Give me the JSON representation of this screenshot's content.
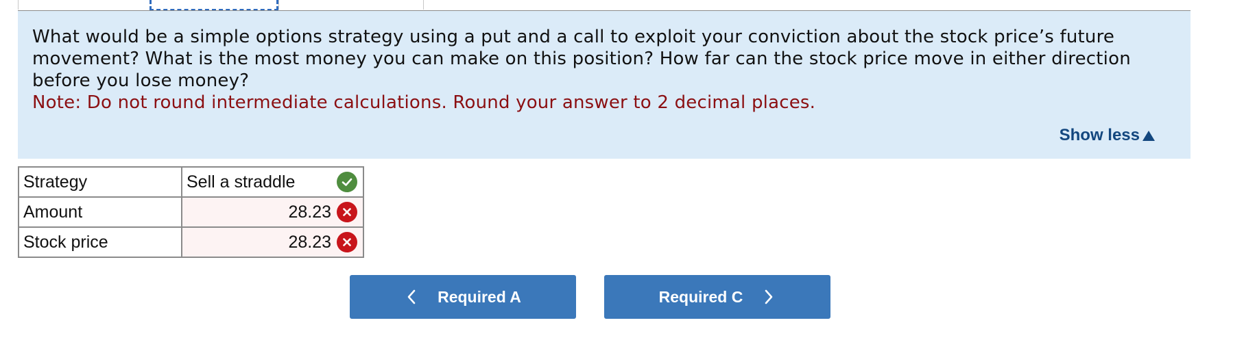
{
  "question": {
    "text": "What would be a simple options strategy using a put and a call to exploit your conviction about the stock price’s future movement? What is the most money you can make on this position? How far can the stock price move in either direction before you lose money?",
    "note": "Note: Do not round intermediate calculations. Round your answer to 2 decimal places.",
    "show_less_label": "Show less"
  },
  "answers": {
    "rows": [
      {
        "label": "Strategy",
        "value": "Sell a straddle",
        "status": "correct"
      },
      {
        "label": "Amount",
        "value": "28.23",
        "status": "incorrect"
      },
      {
        "label": "Stock price",
        "value": "28.23",
        "status": "incorrect"
      }
    ]
  },
  "navigation": {
    "prev_label": "Required A",
    "next_label": "Required C"
  },
  "colors": {
    "panel_background": "#dbebf8",
    "note_text": "#8b0f12",
    "link_text": "#13477f",
    "button_background": "#3b78ba",
    "correct_icon": "#4f8d3f",
    "incorrect_icon": "#c8151b"
  },
  "icons": {
    "correct": "check-circle-icon",
    "incorrect": "x-circle-icon",
    "show_less": "triangle-up-icon",
    "prev": "chevron-left-icon",
    "next": "chevron-right-icon"
  }
}
